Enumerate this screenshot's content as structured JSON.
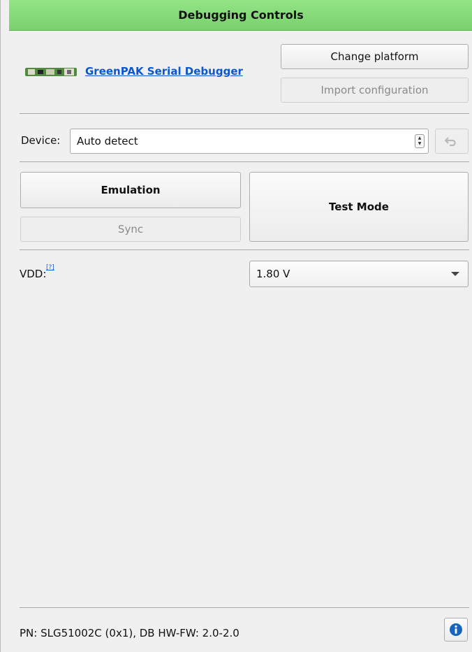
{
  "panel": {
    "title": "Debugging Controls",
    "title_color": "#84da77"
  },
  "platform": {
    "logo_icon": "pcb-board-icon",
    "link_label": "GreenPAK Serial Debugger",
    "change_platform_label": "Change platform",
    "import_configuration_label": "Import configuration"
  },
  "device": {
    "label": "Device:",
    "value": "Auto detect",
    "reset_icon": "undo-icon"
  },
  "modes": {
    "emulation_label": "Emulation",
    "sync_label": "Sync",
    "test_mode_label": "Test Mode"
  },
  "vdd": {
    "label": "VDD:",
    "help_mark": "[?]",
    "value": "1.80 V"
  },
  "status": {
    "text": "PN: SLG51002C (0x1), DB HW-FW: 2.0-2.0",
    "info_icon": "info-icon",
    "info_color": "#1565c0"
  }
}
